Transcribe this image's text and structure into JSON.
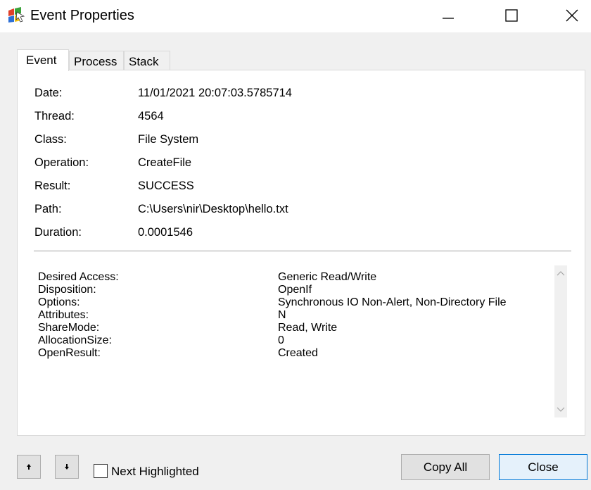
{
  "window": {
    "title": "Event Properties",
    "icon": "procmon-app-icon",
    "controls": {
      "minimize": "minimize-icon",
      "maximize": "maximize-icon",
      "close": "close-icon"
    }
  },
  "tabs": [
    {
      "label": "Event",
      "active": true
    },
    {
      "label": "Process",
      "active": false
    },
    {
      "label": "Stack",
      "active": false
    }
  ],
  "properties": [
    {
      "label": "Date:",
      "value": "11/01/2021 20:07:03.5785714"
    },
    {
      "label": "Thread:",
      "value": "4564"
    },
    {
      "label": "Class:",
      "value": "File System"
    },
    {
      "label": "Operation:",
      "value": "CreateFile"
    },
    {
      "label": "Result:",
      "value": "SUCCESS"
    },
    {
      "label": "Path:",
      "value": "C:\\Users\\nir\\Desktop\\hello.txt"
    },
    {
      "label": "Duration:",
      "value": "0.0001546"
    }
  ],
  "details": [
    {
      "label": "Desired Access:",
      "value": "Generic Read/Write"
    },
    {
      "label": "Disposition:",
      "value": "OpenIf"
    },
    {
      "label": "Options:",
      "value": "Synchronous IO Non-Alert, Non-Directory File"
    },
    {
      "label": "Attributes:",
      "value": "N"
    },
    {
      "label": "ShareMode:",
      "value": "Read, Write"
    },
    {
      "label": "AllocationSize:",
      "value": "0"
    },
    {
      "label": "OpenResult:",
      "value": "Created"
    }
  ],
  "footer": {
    "up_icon": "arrow-up-icon",
    "down_icon": "arrow-down-icon",
    "next_highlighted_label": "Next Highlighted",
    "next_highlighted_checked": false,
    "copy_all_label": "Copy All",
    "close_label": "Close"
  },
  "colors": {
    "accent": "#0078d7",
    "dialog_bg": "#f0f0f0",
    "panel_bg": "#ffffff"
  }
}
